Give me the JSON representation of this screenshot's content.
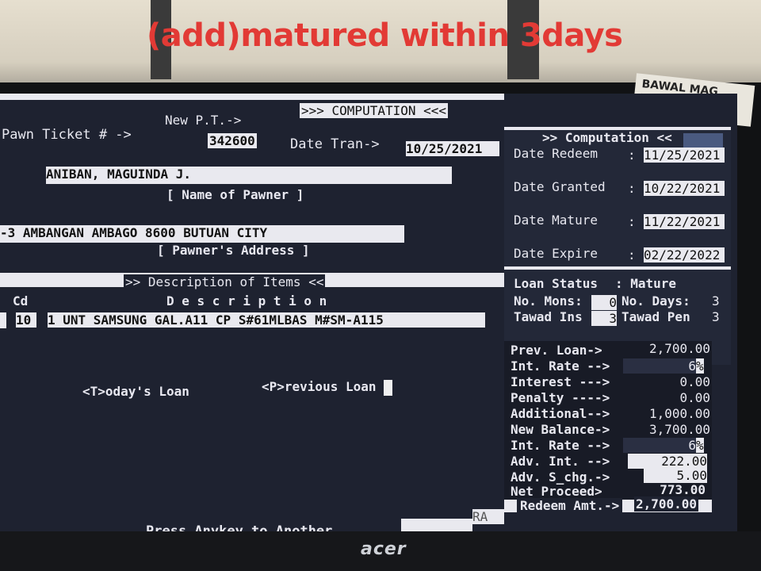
{
  "overlay_caption": "(add)matured within 3days",
  "sticker_note": "BAWAL MAG ZERO \"O\"",
  "monitor_brand": "acer",
  "screen": {
    "header": ">>> COMPUTATION <<<",
    "new_pt_label": "New P.T.->",
    "pawn_ticket_label": "Pawn Ticket # ->",
    "pawn_ticket_no": "342600",
    "date_tran_label": "Date Tran->",
    "date_tran": "10/25/2021",
    "pawner_name": "ANIBAN, MAGUINDA J.",
    "pawner_name_caption": "[ Name of Pawner ]",
    "pawner_address": "-3 AMBANGAN AMBAGO 8600 BUTUAN CITY",
    "pawner_address_caption": "[ Pawner's Address ]",
    "items_header": ">> Description of Items <<",
    "col_cd": "Cd",
    "col_description": "D e s c r i p t i o n",
    "item_qty_fragment": "",
    "item_cd": "10",
    "item_description": "1 UNT SAMSUNG GAL.A11 CP S#61MLBAS M#SM-A115",
    "todays_loan_option": "<T>oday's Loan",
    "previous_loan_option": "<P>revious Loan",
    "press_anykey": "Press Anykey to Another",
    "ra_label": "RA",
    "computation_panel": {
      "title": ">> Computation <<",
      "date_redeem_label": "Date Redeem",
      "date_redeem": "11/25/2021",
      "date_granted_label": "Date Granted",
      "date_granted": "10/22/2021",
      "date_mature_label": "Date Mature",
      "date_mature": "11/22/2021",
      "date_expire_label": "Date Expire",
      "date_expire": "02/22/2022",
      "loan_status_label": "Loan Status",
      "loan_status": ": Mature",
      "no_mons_label": "No. Mons:",
      "no_mons": "0",
      "no_days_label": "No. Days:",
      "no_days": "3",
      "tawad_ins_label": "Tawad Ins",
      "tawad_ins": "3",
      "tawad_pen_label": "Tawad Pen",
      "tawad_pen": "3"
    },
    "amounts": [
      {
        "label": "Prev. Loan->",
        "value": "2,700.00"
      },
      {
        "label": "Int. Rate -->",
        "value": "6",
        "suffix": "%"
      },
      {
        "label": "Interest --->",
        "value": "0.00"
      },
      {
        "label": "Penalty ---->",
        "value": "0.00"
      },
      {
        "label": "Additional-->",
        "value": "1,000.00"
      },
      {
        "label": "New Balance->",
        "value": "3,700.00"
      },
      {
        "label": "Int. Rate -->",
        "value": "6",
        "suffix": "%"
      },
      {
        "label": "Adv. Int. -->",
        "value": "222.00"
      },
      {
        "label": "Adv. S_chg.->",
        "value": "5.00"
      },
      {
        "label": "Net Proceed>",
        "value": "773.00"
      },
      {
        "label": "Redeem Amt.->",
        "value": "2,700.00"
      }
    ]
  }
}
